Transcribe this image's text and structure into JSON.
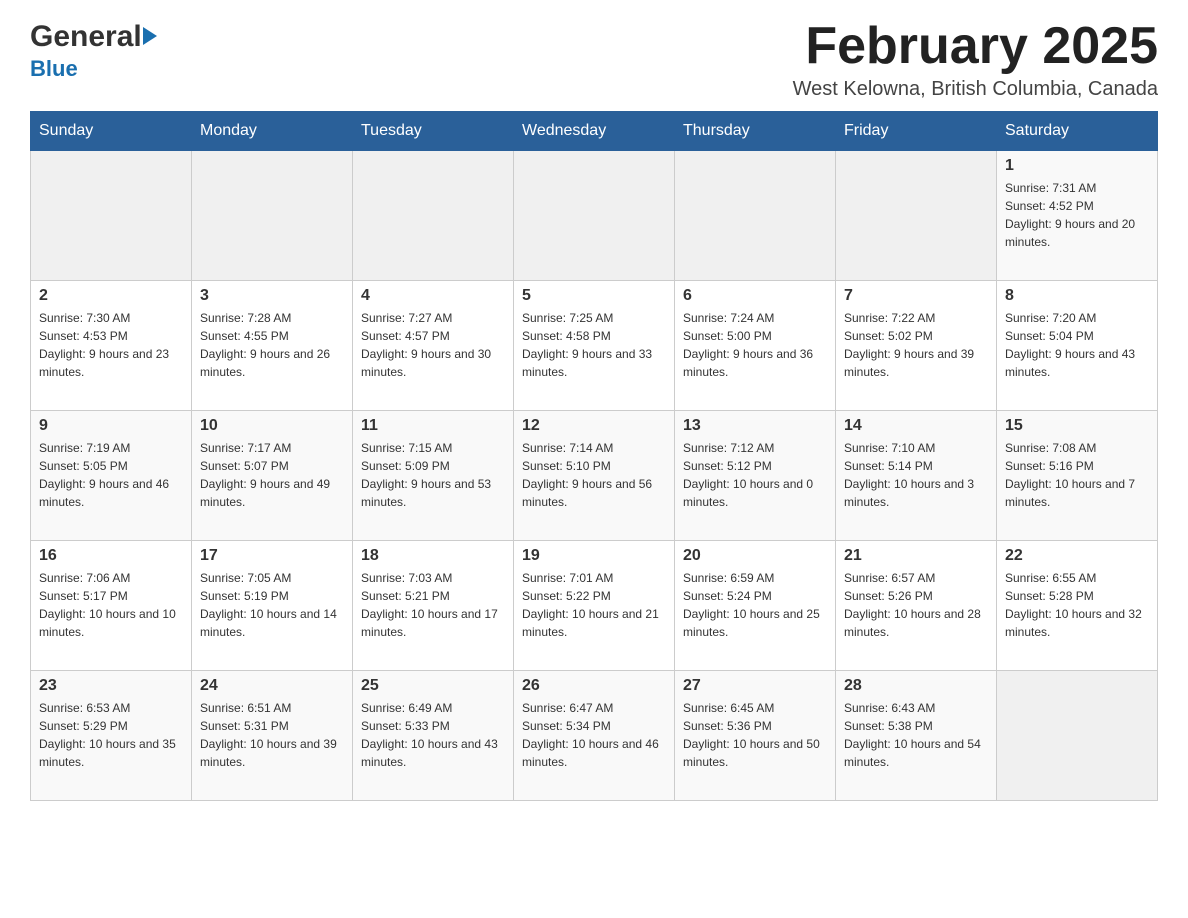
{
  "header": {
    "logo_general": "General",
    "logo_blue": "Blue",
    "month_title": "February 2025",
    "location": "West Kelowna, British Columbia, Canada"
  },
  "days_of_week": [
    "Sunday",
    "Monday",
    "Tuesday",
    "Wednesday",
    "Thursday",
    "Friday",
    "Saturday"
  ],
  "weeks": [
    {
      "cells": [
        {
          "day": "",
          "info": ""
        },
        {
          "day": "",
          "info": ""
        },
        {
          "day": "",
          "info": ""
        },
        {
          "day": "",
          "info": ""
        },
        {
          "day": "",
          "info": ""
        },
        {
          "day": "",
          "info": ""
        },
        {
          "day": "1",
          "info": "Sunrise: 7:31 AM\nSunset: 4:52 PM\nDaylight: 9 hours and 20 minutes."
        }
      ]
    },
    {
      "cells": [
        {
          "day": "2",
          "info": "Sunrise: 7:30 AM\nSunset: 4:53 PM\nDaylight: 9 hours and 23 minutes."
        },
        {
          "day": "3",
          "info": "Sunrise: 7:28 AM\nSunset: 4:55 PM\nDaylight: 9 hours and 26 minutes."
        },
        {
          "day": "4",
          "info": "Sunrise: 7:27 AM\nSunset: 4:57 PM\nDaylight: 9 hours and 30 minutes."
        },
        {
          "day": "5",
          "info": "Sunrise: 7:25 AM\nSunset: 4:58 PM\nDaylight: 9 hours and 33 minutes."
        },
        {
          "day": "6",
          "info": "Sunrise: 7:24 AM\nSunset: 5:00 PM\nDaylight: 9 hours and 36 minutes."
        },
        {
          "day": "7",
          "info": "Sunrise: 7:22 AM\nSunset: 5:02 PM\nDaylight: 9 hours and 39 minutes."
        },
        {
          "day": "8",
          "info": "Sunrise: 7:20 AM\nSunset: 5:04 PM\nDaylight: 9 hours and 43 minutes."
        }
      ]
    },
    {
      "cells": [
        {
          "day": "9",
          "info": "Sunrise: 7:19 AM\nSunset: 5:05 PM\nDaylight: 9 hours and 46 minutes."
        },
        {
          "day": "10",
          "info": "Sunrise: 7:17 AM\nSunset: 5:07 PM\nDaylight: 9 hours and 49 minutes."
        },
        {
          "day": "11",
          "info": "Sunrise: 7:15 AM\nSunset: 5:09 PM\nDaylight: 9 hours and 53 minutes."
        },
        {
          "day": "12",
          "info": "Sunrise: 7:14 AM\nSunset: 5:10 PM\nDaylight: 9 hours and 56 minutes."
        },
        {
          "day": "13",
          "info": "Sunrise: 7:12 AM\nSunset: 5:12 PM\nDaylight: 10 hours and 0 minutes."
        },
        {
          "day": "14",
          "info": "Sunrise: 7:10 AM\nSunset: 5:14 PM\nDaylight: 10 hours and 3 minutes."
        },
        {
          "day": "15",
          "info": "Sunrise: 7:08 AM\nSunset: 5:16 PM\nDaylight: 10 hours and 7 minutes."
        }
      ]
    },
    {
      "cells": [
        {
          "day": "16",
          "info": "Sunrise: 7:06 AM\nSunset: 5:17 PM\nDaylight: 10 hours and 10 minutes."
        },
        {
          "day": "17",
          "info": "Sunrise: 7:05 AM\nSunset: 5:19 PM\nDaylight: 10 hours and 14 minutes."
        },
        {
          "day": "18",
          "info": "Sunrise: 7:03 AM\nSunset: 5:21 PM\nDaylight: 10 hours and 17 minutes."
        },
        {
          "day": "19",
          "info": "Sunrise: 7:01 AM\nSunset: 5:22 PM\nDaylight: 10 hours and 21 minutes."
        },
        {
          "day": "20",
          "info": "Sunrise: 6:59 AM\nSunset: 5:24 PM\nDaylight: 10 hours and 25 minutes."
        },
        {
          "day": "21",
          "info": "Sunrise: 6:57 AM\nSunset: 5:26 PM\nDaylight: 10 hours and 28 minutes."
        },
        {
          "day": "22",
          "info": "Sunrise: 6:55 AM\nSunset: 5:28 PM\nDaylight: 10 hours and 32 minutes."
        }
      ]
    },
    {
      "cells": [
        {
          "day": "23",
          "info": "Sunrise: 6:53 AM\nSunset: 5:29 PM\nDaylight: 10 hours and 35 minutes."
        },
        {
          "day": "24",
          "info": "Sunrise: 6:51 AM\nSunset: 5:31 PM\nDaylight: 10 hours and 39 minutes."
        },
        {
          "day": "25",
          "info": "Sunrise: 6:49 AM\nSunset: 5:33 PM\nDaylight: 10 hours and 43 minutes."
        },
        {
          "day": "26",
          "info": "Sunrise: 6:47 AM\nSunset: 5:34 PM\nDaylight: 10 hours and 46 minutes."
        },
        {
          "day": "27",
          "info": "Sunrise: 6:45 AM\nSunset: 5:36 PM\nDaylight: 10 hours and 50 minutes."
        },
        {
          "day": "28",
          "info": "Sunrise: 6:43 AM\nSunset: 5:38 PM\nDaylight: 10 hours and 54 minutes."
        },
        {
          "day": "",
          "info": ""
        }
      ]
    }
  ]
}
